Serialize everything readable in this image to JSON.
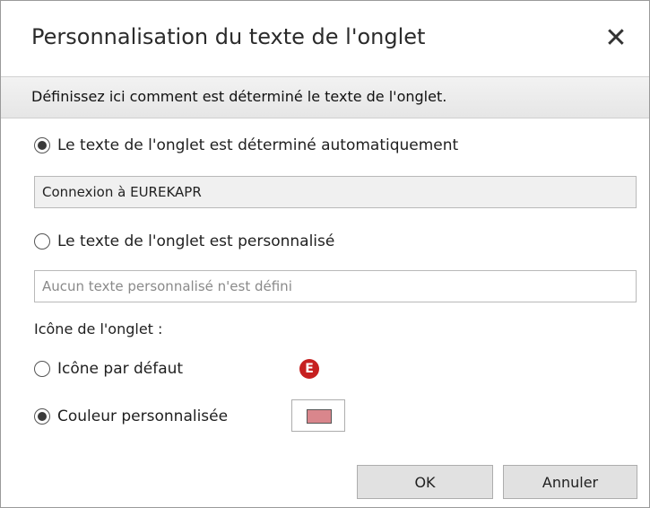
{
  "dialog": {
    "title": "Personnalisation du texte de l'onglet",
    "close_glyph": "✕",
    "banner": "Définissez ici comment est déterminé le texte de l'onglet."
  },
  "tab_text": {
    "auto_option_label": "Le texte de l'onglet est déterminé automatiquement",
    "auto_selected": true,
    "auto_value": "Connexion à EUREKAPR",
    "custom_option_label": "Le texte de l'onglet est personnalisé",
    "custom_selected": false,
    "custom_placeholder": "Aucun texte personnalisé n'est défini",
    "custom_value": ""
  },
  "tab_icon": {
    "section_label": "Icône de l'onglet :",
    "default_option_label": "Icône par défaut",
    "default_selected": false,
    "default_icon": "e-letter-icon",
    "default_icon_letter": "E",
    "default_icon_color": "#c62020",
    "custom_color_option_label": "Couleur personnalisée",
    "custom_color_selected": true,
    "custom_color": "#d9868c"
  },
  "buttons": {
    "ok_label": "OK",
    "cancel_label": "Annuler"
  }
}
